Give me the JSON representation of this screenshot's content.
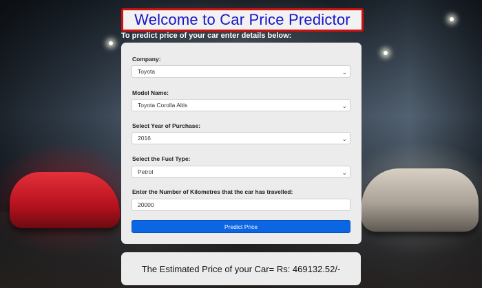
{
  "header": {
    "title": "Welcome to Car Price Predictor",
    "subtitle": "To predict price of your car enter details below:"
  },
  "form": {
    "company": {
      "label": "Company:",
      "value": "Toyota"
    },
    "model": {
      "label": "Model Name:",
      "value": "Toyota Corolla Altis"
    },
    "year": {
      "label": "Select Year of Purchase:",
      "value": "2016"
    },
    "fuel": {
      "label": "Select the Fuel Type:",
      "value": "Petrol"
    },
    "kms": {
      "label": "Enter the Number of Kilometres that the car has travelled:",
      "value": "20000"
    },
    "submit_label": "Predict Price"
  },
  "result": {
    "text": "The Estimated Price of your Car= Rs: 469132.52/-"
  },
  "colors": {
    "title_text": "#1515c8",
    "title_border": "#d01010",
    "button": "#0b66e4"
  }
}
